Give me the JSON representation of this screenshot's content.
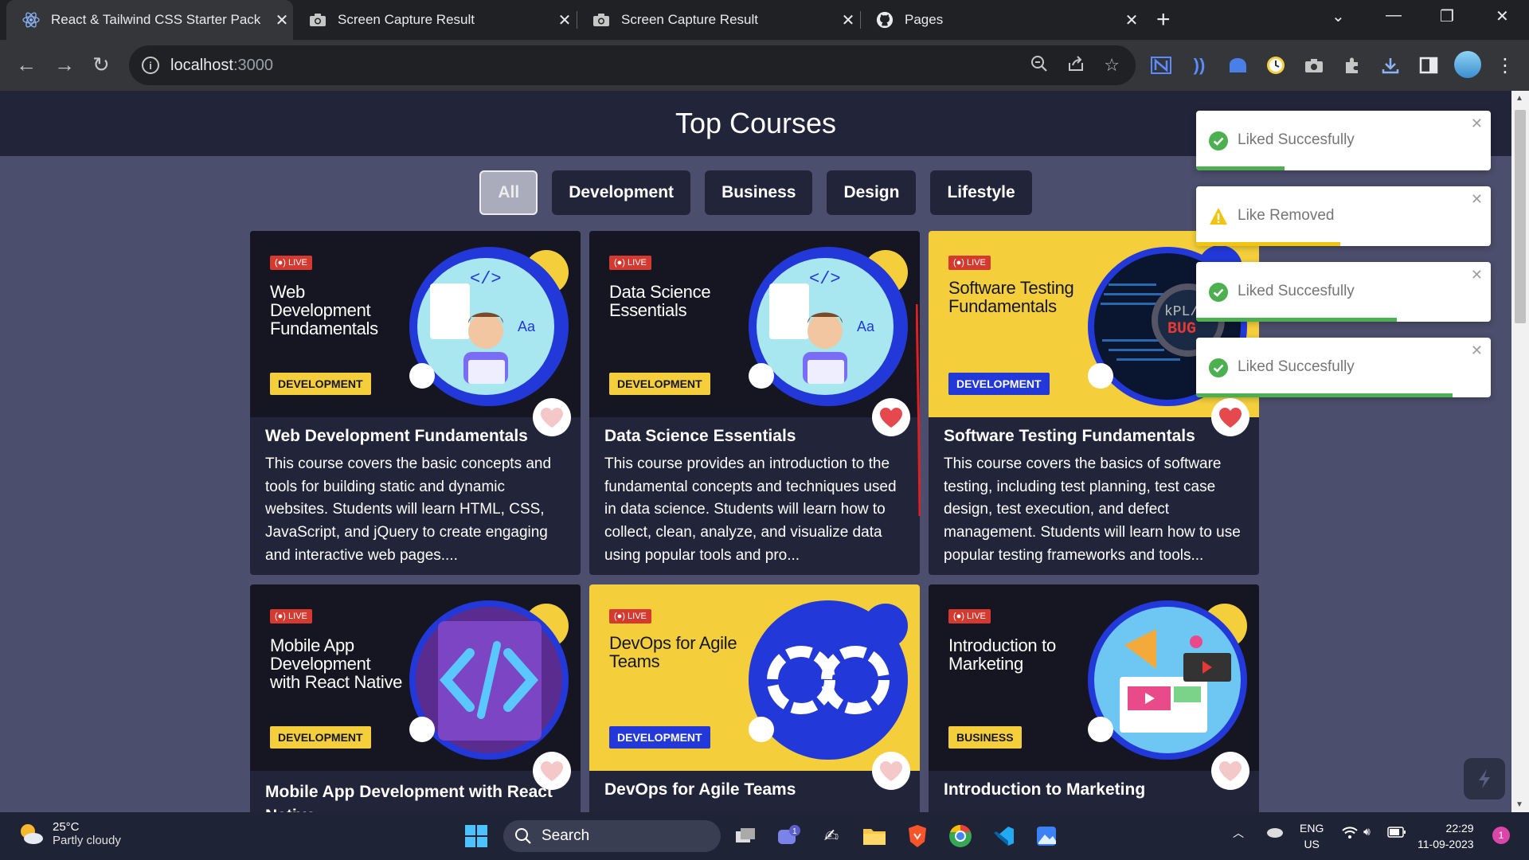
{
  "browser": {
    "tabs": [
      {
        "title": "React & Tailwind CSS Starter Pack",
        "active": true,
        "icon": "react-icon"
      },
      {
        "title": "Screen Capture Result",
        "active": false,
        "icon": "camera-icon"
      },
      {
        "title": "Screen Capture Result",
        "active": false,
        "icon": "camera-icon"
      },
      {
        "title": "Pages",
        "active": false,
        "icon": "github-icon"
      }
    ],
    "url_host": "localhost",
    "url_port": ":3000"
  },
  "page": {
    "title": "Top Courses",
    "filters": [
      "All",
      "Development",
      "Business",
      "Design",
      "Lifestyle"
    ],
    "active_filter": "All"
  },
  "courses": [
    {
      "thumb_title": "Web Development Fundamentals",
      "live": "LIVE",
      "tag": "DEVELOPMENT",
      "title": "Web Development Fundamentals",
      "description": "This course covers the basic concepts and tools for building static and dynamic websites. Students will learn HTML, CSS, JavaScript, and jQuery to create engaging and interactive web pages....",
      "liked": false,
      "thumb_style": "dark"
    },
    {
      "thumb_title": "Data Science Essentials",
      "live": "LIVE",
      "tag": "DEVELOPMENT",
      "title": "Data Science Essentials",
      "description": "This course provides an introduction to the fundamental concepts and techniques used in data science. Students will learn how to collect, clean, analyze, and visualize data using popular tools and pro...",
      "liked": true,
      "thumb_style": "dark"
    },
    {
      "thumb_title": "Software Testing Fundamentals",
      "live": "LIVE",
      "tag": "DEVELOPMENT",
      "title": "Software Testing Fundamentals",
      "description": "This course covers the basics of software testing, including test planning, test case design, test execution, and defect management. Students will learn how to use popular testing frameworks and tools...",
      "liked": true,
      "thumb_style": "yellow"
    },
    {
      "thumb_title": "Mobile App Development with React Native",
      "live": "LIVE",
      "tag": "DEVELOPMENT",
      "title": "Mobile App Development with React Native",
      "description": "",
      "liked": false,
      "thumb_style": "dark"
    },
    {
      "thumb_title": "DevOps for Agile Teams",
      "live": "LIVE",
      "tag": "DEVELOPMENT",
      "title": "DevOps for Agile Teams",
      "description": "",
      "liked": false,
      "thumb_style": "yellow"
    },
    {
      "thumb_title": "Introduction to Marketing",
      "live": "LIVE",
      "tag": "BUSINESS",
      "title": "Introduction to Marketing",
      "description": "",
      "liked": false,
      "thumb_style": "dark"
    }
  ],
  "toasts": [
    {
      "message": "Liked Succesfully",
      "type": "success",
      "progress": 0.3
    },
    {
      "message": "Like Removed",
      "type": "warning",
      "progress": 0.49
    },
    {
      "message": "Liked Succesfully",
      "type": "success",
      "progress": 0.68
    },
    {
      "message": "Liked Succesfully",
      "type": "success",
      "progress": 0.87
    }
  ],
  "taskbar": {
    "weather_temp": "25°C",
    "weather_desc": "Partly cloudy",
    "search_label": "Search",
    "lang_1": "ENG",
    "lang_2": "US",
    "time": "22:29",
    "date": "11-09-2023",
    "teams_badge": "1",
    "notification_badge": "1"
  },
  "colors": {
    "accent_yellow": "#f4cf3b",
    "accent_blue": "#2238d8",
    "success_green": "#4caf50",
    "warning_yellow": "#f1c40f",
    "heart_red": "#e5484d"
  }
}
